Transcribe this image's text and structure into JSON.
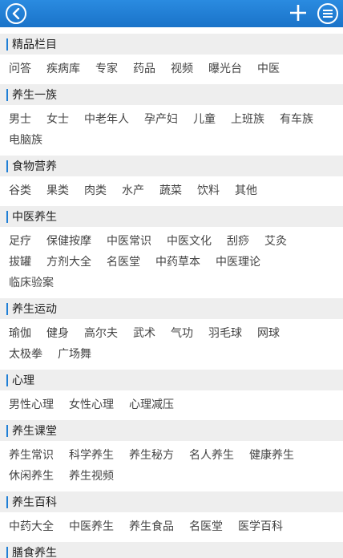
{
  "topbar": {
    "back_icon": "back-arrow-icon",
    "add_icon": "plus-icon",
    "menu_icon": "menu-icon",
    "accent_color": "#1f7fd6"
  },
  "sections": [
    {
      "title": "精品栏目",
      "tags": [
        "问答",
        "疾病库",
        "专家",
        "药品",
        "视频",
        "曝光台",
        "中医"
      ]
    },
    {
      "title": "养生一族",
      "tags": [
        "男士",
        "女士",
        "中老年人",
        "孕产妇",
        "儿童",
        "上班族",
        "有车族",
        "电脑族"
      ]
    },
    {
      "title": "食物营养",
      "tags": [
        "谷类",
        "果类",
        "肉类",
        "水产",
        "蔬菜",
        "饮料",
        "其他"
      ]
    },
    {
      "title": "中医养生",
      "tags": [
        "足疗",
        "保健按摩",
        "中医常识",
        "中医文化",
        "刮痧",
        "艾灸",
        "拔罐",
        "方剂大全",
        "名医堂",
        "中药草本",
        "中医理论",
        "临床验案"
      ]
    },
    {
      "title": "养生运动",
      "tags": [
        "瑜伽",
        "健身",
        "高尔夫",
        "武术",
        "气功",
        "羽毛球",
        "网球",
        "太极拳",
        "广场舞"
      ]
    },
    {
      "title": "心理",
      "tags": [
        "男性心理",
        "女性心理",
        "心理减压"
      ]
    },
    {
      "title": "养生课堂",
      "tags": [
        "养生常识",
        "科学养生",
        "养生秘方",
        "名人养生",
        "健康养生",
        "休闲养生",
        "养生视频"
      ]
    },
    {
      "title": "养生百科",
      "tags": [
        "中药大全",
        "中医养生",
        "养生食品",
        "名医堂",
        "医学百科"
      ]
    },
    {
      "title": "膳食养生",
      "tags": []
    }
  ]
}
